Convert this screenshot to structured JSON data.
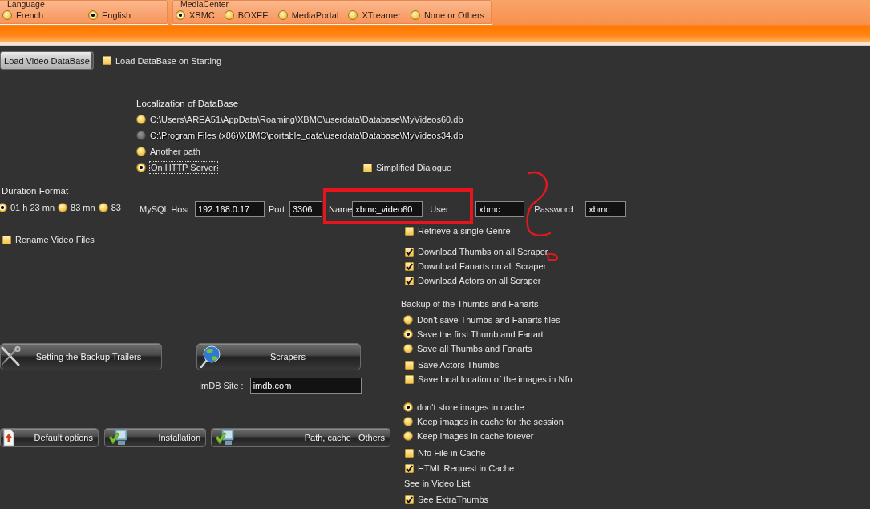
{
  "language": {
    "title": "Language",
    "options": [
      {
        "label": "French",
        "selected": false
      },
      {
        "label": "English",
        "selected": true
      }
    ]
  },
  "media_center": {
    "title": "MediaCenter",
    "options": [
      {
        "label": "XBMC",
        "selected": true
      },
      {
        "label": "BOXEE",
        "selected": false
      },
      {
        "label": "MediaPortal",
        "selected": false
      },
      {
        "label": "XTreamer",
        "selected": false
      },
      {
        "label": "None or Others",
        "selected": false
      }
    ]
  },
  "load_button": "Load Video DataBase",
  "load_on_start": {
    "label": "Load DataBase on Starting",
    "checked": false
  },
  "database_location": {
    "title": "Localization of DataBase",
    "options": [
      {
        "label": "C:\\Users\\AREA51\\AppData\\Roaming\\XBMC\\userdata\\Database\\MyVideos60.db",
        "selected": false,
        "disabled": false,
        "focused": false
      },
      {
        "label": "C:\\Program Files (x86)\\XBMC\\portable_data\\userdata\\Database\\MyVideos34.db",
        "selected": false,
        "disabled": true,
        "focused": false
      },
      {
        "label": "Another path",
        "selected": false,
        "disabled": false,
        "focused": false
      },
      {
        "label": "On HTTP Server",
        "selected": true,
        "disabled": false,
        "focused": true
      }
    ]
  },
  "simplified_dialogue": {
    "label": "Simplified Dialogue",
    "checked": false
  },
  "duration_format": {
    "title": "Duration Format",
    "options": [
      {
        "label": "01 h 23 mn",
        "selected": true
      },
      {
        "label": "83 mn",
        "selected": false
      },
      {
        "label": "83",
        "selected": false
      }
    ]
  },
  "rename_video_files": {
    "label": "Rename Video Files",
    "checked": false
  },
  "mysql": [
    {
      "label": "MySQL Host",
      "value": "192.168.0.17"
    },
    {
      "label": "Port",
      "value": "3306"
    },
    {
      "label": "Name",
      "value": "xbmc_video60"
    },
    {
      "label": "User",
      "value": "xbmc"
    },
    {
      "label": "Password",
      "value": "xbmc"
    }
  ],
  "genre_option": {
    "label": "Retrieve a single Genre",
    "checked": false
  },
  "scraper_downloads": [
    {
      "label": "Download Thumbs on all Scraper",
      "checked": true
    },
    {
      "label": "Download Fanarts on all Scraper",
      "checked": true
    },
    {
      "label": "Download Actors on all Scraper",
      "checked": true
    }
  ],
  "thumbs_backup": {
    "title": "Backup of the Thumbs and Fanarts",
    "modes": [
      {
        "label": "Don't save Thumbs and Fanarts files",
        "selected": false
      },
      {
        "label": "Save the first Thumb and Fanart",
        "selected": true
      },
      {
        "label": "Save all Thumbs and Fanarts",
        "selected": false
      }
    ],
    "options": [
      {
        "label": "Save Actors Thumbs",
        "checked": false
      },
      {
        "label": "Save local location of the images in Nfo",
        "checked": false
      }
    ]
  },
  "image_cache": {
    "modes": [
      {
        "label": "don't store images in cache",
        "selected": true
      },
      {
        "label": "Keep images in cache for the session",
        "selected": false
      },
      {
        "label": "Keep images in cache forever",
        "selected": false
      }
    ],
    "options": [
      {
        "label": "Nfo File in Cache",
        "checked": false
      },
      {
        "label": "HTML Request in Cache",
        "checked": true
      }
    ]
  },
  "video_list": {
    "title": "See in Video List",
    "options": [
      {
        "label": "See ExtraThumbs",
        "checked": true
      }
    ]
  },
  "trailers_button": "Setting the Backup Trailers",
  "scrapers_button": "Scrapers",
  "imdb_site": {
    "label": "ImDB Site :",
    "value": "imdb.com"
  },
  "bottom_buttons": [
    "Default options",
    "Installation",
    "Path, cache _Others"
  ]
}
